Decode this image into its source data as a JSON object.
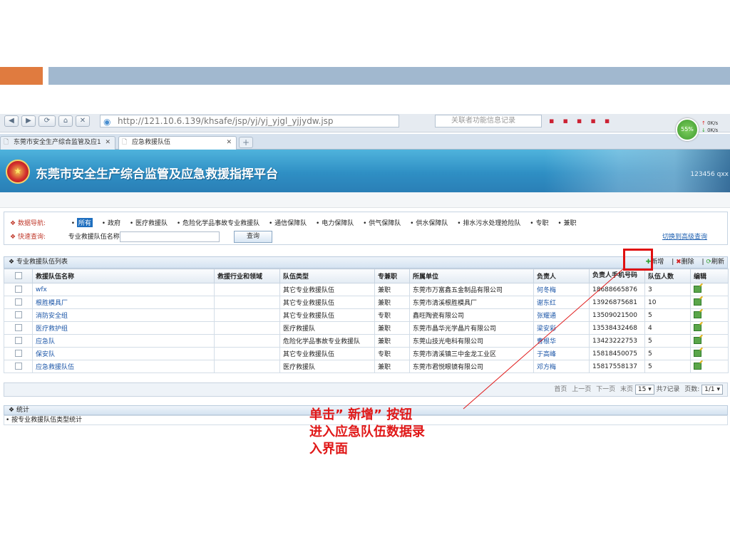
{
  "colors": {
    "accent_orange": "#e07b3f",
    "header_bar": "#a1b8cf",
    "annotation_red": "#e01818",
    "link_blue": "#1d57a8"
  },
  "browser": {
    "url": "http://121.10.6.139/khsafe/jsp/yj/yj_yjgl_yjjydw.jsp",
    "search_placeholder": "关联者功能信息记录",
    "speed": {
      "percent": "55%",
      "up": "0K/s",
      "down": "0K/s"
    },
    "tabs": [
      {
        "label": "东莞市安全生产综合监管及应1"
      },
      {
        "label": "应急救援队伍"
      }
    ],
    "icons": {
      "back": "back-arrow-icon",
      "forward": "forward-arrow-icon",
      "home": "home-icon",
      "stop": "stop-icon"
    }
  },
  "app": {
    "title": "东莞市安全生产综合监管及应急救援指挥平台",
    "user": "123456    qxx"
  },
  "filter": {
    "nav_label": "数据导航:",
    "nav_items": [
      "所有",
      "政府",
      "医疗救援队",
      "危险化学品事故专业救援队",
      "通信保障队",
      "电力保障队",
      "供气保障队",
      "供水保障队",
      "排水污水处理抢险队",
      "专职",
      "兼职"
    ],
    "quick_label": "快速查询:",
    "query_field_label": "专业救援队伍名称",
    "query_value": "",
    "query_button": "查询",
    "advanced_link": "切换到高级查询"
  },
  "list": {
    "title": "专业救援队伍列表",
    "actions": {
      "add": "新增",
      "delete": "删除",
      "refresh": "刷新"
    },
    "columns": [
      "救援队伍名称",
      "救援行业和领域",
      "队伍类型",
      "专兼职",
      "所属单位",
      "负责人",
      "负责人手机号码",
      "队伍人数",
      "编辑"
    ],
    "rows": [
      {
        "name": "wfx",
        "field": "",
        "type": "其它专业救援队伍",
        "duty": "兼职",
        "unit": "东莞市万富鑫五金制品有限公司",
        "leader": "何冬梅",
        "phone": "18688665876",
        "size": "3"
      },
      {
        "name": "根胜模具厂",
        "field": "",
        "type": "其它专业救援队伍",
        "duty": "兼职",
        "unit": "东莞市清溪根胜模具厂",
        "leader": "谢东红",
        "phone": "13926875681",
        "size": "10"
      },
      {
        "name": "消防安全组",
        "field": "",
        "type": "其它专业救援队伍",
        "duty": "专职",
        "unit": "鑫旺陶瓷有限公司",
        "leader": "张耀通",
        "phone": "13509021500",
        "size": "5"
      },
      {
        "name": "医疗救护组",
        "field": "",
        "type": "医疗救援队",
        "duty": "兼职",
        "unit": "东莞市晶华光学晶片有限公司",
        "leader": "梁安彩",
        "phone": "13538432468",
        "size": "4"
      },
      {
        "name": "应急队",
        "field": "",
        "type": "危险化学品事故专业救援队",
        "duty": "兼职",
        "unit": "东莞山技光电科有限公司",
        "leader": "曹根华",
        "phone": "13423222753",
        "size": "5"
      },
      {
        "name": "保安队",
        "field": "",
        "type": "其它专业救援队伍",
        "duty": "专职",
        "unit": "东莞市清溪镇三中金龙工业区",
        "leader": "于高峰",
        "phone": "15818450075",
        "size": "5"
      },
      {
        "name": "应急救援队伍",
        "field": "",
        "type": "医疗救援队",
        "duty": "兼职",
        "unit": "东莞市君悦眼镜有限公司",
        "leader": "邓方梅",
        "phone": "15817558137",
        "size": "5"
      }
    ],
    "pager": {
      "first": "首页",
      "prev": "上一页",
      "next": "下一页",
      "last": "末页",
      "page_size": "15",
      "total": "共7记录",
      "page_label": "页数:",
      "page": "1/1"
    }
  },
  "stats": {
    "title": "统计",
    "item": "按专业救援队伍类型统计"
  },
  "annotation": {
    "line1": "单击” 新增” 按钮",
    "line2": "进入应急队伍数据录",
    "line3": "入界面"
  }
}
